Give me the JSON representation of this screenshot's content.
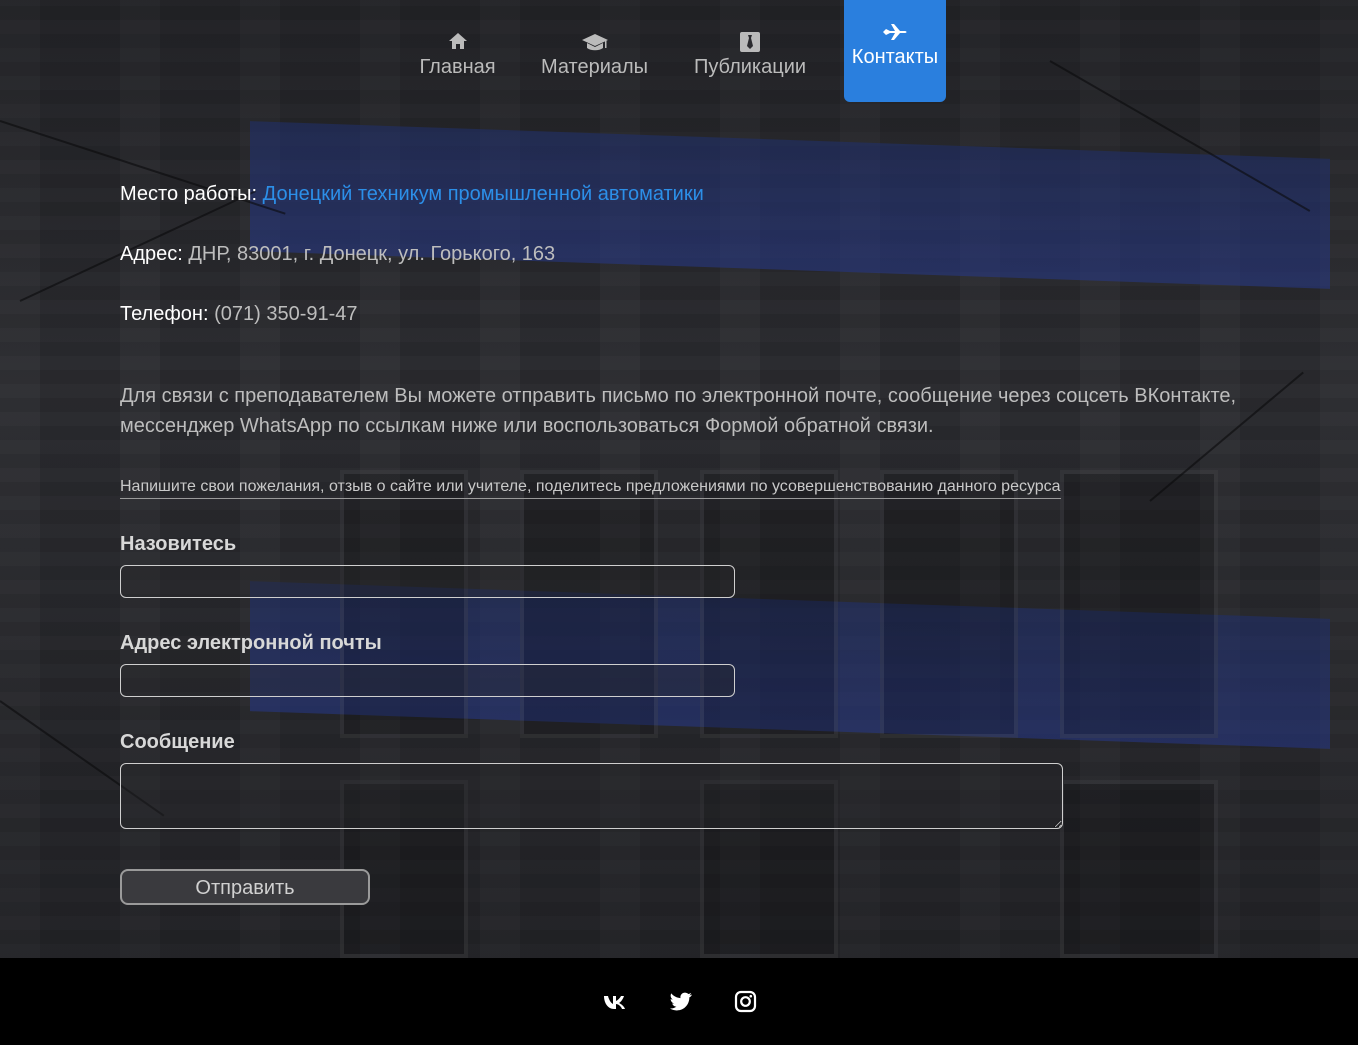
{
  "nav": {
    "items": [
      {
        "label": "Главная",
        "icon": "home-icon"
      },
      {
        "label": "Материалы",
        "icon": "graduation-cap-icon"
      },
      {
        "label": "Публикации",
        "icon": "tie-icon"
      },
      {
        "label": "Контакты",
        "icon": "plane-icon",
        "active": true
      }
    ]
  },
  "contacts": {
    "work_label": "Место работы:",
    "work_value": "Донецкий техникум промышленной автоматики",
    "address_label": "Адрес:",
    "address_value": "ДНР, 83001, г. Донецк, ул. Горького, 163",
    "phone_label": "Телефон:",
    "phone_value": "(071) 350-91-47"
  },
  "description": "Для связи с преподавателем Вы можете отправить письмо по электронной почте, сообщение через соцсеть ВКонтакте, мессенджер WhatsApp по ссылкам ниже или воспользоваться Формой обратной связи.",
  "form": {
    "hint": "Напишите свои пожелания, отзыв о сайте или учителе, поделитесь предложениями по усовершенствованию данного ресурса",
    "name_label": "Назовитесь",
    "name_value": "",
    "email_label": "Адрес электронной почты",
    "email_value": "",
    "message_label": "Сообщение",
    "message_value": "",
    "submit_label": "Отправить"
  },
  "footer": {
    "social": [
      "vk-icon",
      "twitter-icon",
      "instagram-icon"
    ]
  },
  "colors": {
    "accent": "#2a7fde",
    "link": "#2c8fe8",
    "footer_bg": "#000000"
  }
}
